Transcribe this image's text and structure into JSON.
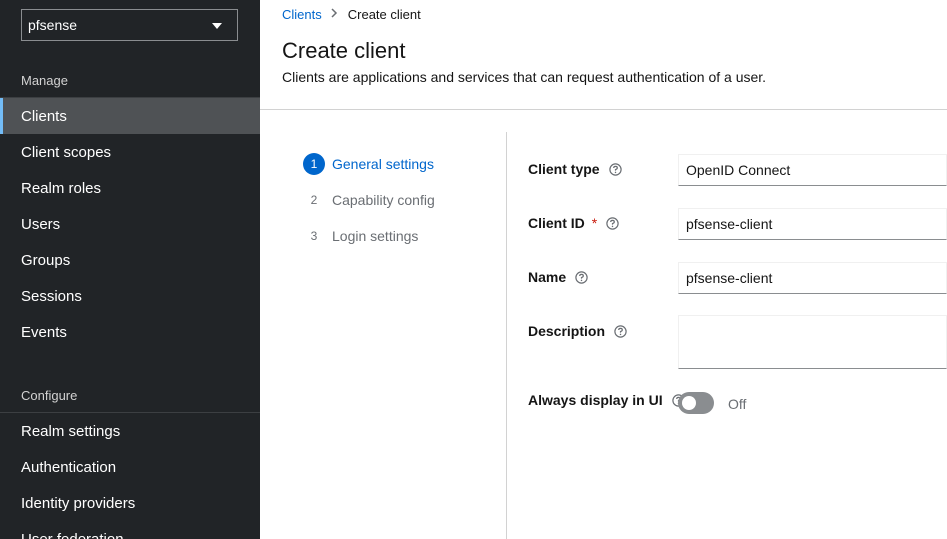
{
  "sidebar": {
    "realm": "pfsense",
    "manage_title": "Manage",
    "configure_title": "Configure",
    "manage_items": [
      {
        "label": "Clients"
      },
      {
        "label": "Client scopes"
      },
      {
        "label": "Realm roles"
      },
      {
        "label": "Users"
      },
      {
        "label": "Groups"
      },
      {
        "label": "Sessions"
      },
      {
        "label": "Events"
      }
    ],
    "configure_items": [
      {
        "label": "Realm settings"
      },
      {
        "label": "Authentication"
      },
      {
        "label": "Identity providers"
      },
      {
        "label": "User federation"
      }
    ],
    "active_item": "Clients"
  },
  "breadcrumb": {
    "parent": "Clients",
    "current": "Create client"
  },
  "page": {
    "title": "Create client",
    "description": "Clients are applications and services that can request authentication of a user."
  },
  "wizard": {
    "steps": [
      {
        "num": "1",
        "label": "General settings"
      },
      {
        "num": "2",
        "label": "Capability config"
      },
      {
        "num": "3",
        "label": "Login settings"
      }
    ],
    "active_step": 1
  },
  "form": {
    "client_type": {
      "label": "Client type",
      "value": "OpenID Connect"
    },
    "client_id": {
      "label": "Client ID",
      "required_mark": "*",
      "value": "pfsense-client"
    },
    "name": {
      "label": "Name",
      "value": "pfsense-client"
    },
    "description": {
      "label": "Description",
      "value": ""
    },
    "always_display": {
      "label": "Always display in UI",
      "state": "Off",
      "checked": false
    }
  },
  "colors": {
    "sidebar_bg": "#212427",
    "active_nav_bg": "#4f5255",
    "active_accent": "#73bcf7",
    "link": "#0066cc",
    "required": "#c9190b"
  },
  "icons": {
    "help": "help-circle-icon",
    "caret": "caret-down-icon",
    "breadcrumb_separator": "chevron-right-icon"
  }
}
